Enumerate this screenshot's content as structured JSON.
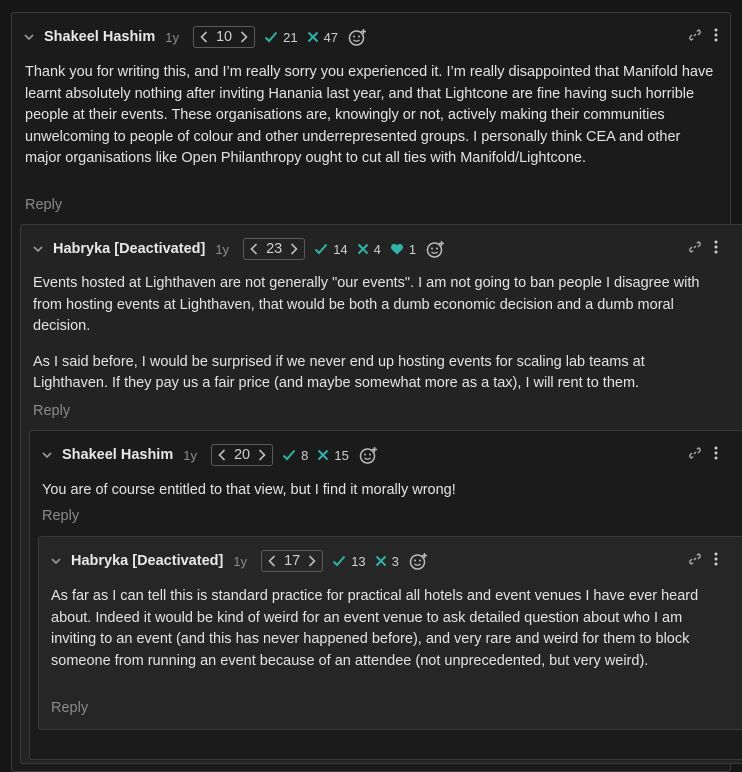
{
  "colors": {
    "accent": "#2fb3a8",
    "text": "#e3e3e3",
    "muted": "#8a8a8a",
    "border": "#3a3a3a"
  },
  "reply_label": "Reply",
  "comments": [
    {
      "author": "Shakeel Hashim",
      "age": "1y",
      "karma": "10",
      "agree": "21",
      "disagree": "47",
      "paragraphs": [
        "Thank you for writing this, and I’m really sorry you experienced it. I’m really disappointed that Manifold have learnt absolutely nothing after inviting Hanania last year, and that Lightcone are fine having such horrible people at their events. These organisations are, knowingly or not, actively making their communities unwelcoming to people of colour and other underrepresented groups. I personally think CEA and other major organisations like Open Philanthropy ought to cut all ties with Manifold/Lightcone."
      ]
    },
    {
      "author": "Habryka [Deactivated]",
      "age": "1y",
      "karma": "23",
      "agree": "14",
      "disagree": "4",
      "hearts": "1",
      "paragraphs": [
        "Events hosted at Lighthaven are not generally \"our events\". I am not going to ban people I disagree with from hosting events at Lighthaven, that would be both a dumb economic decision and a dumb moral decision.",
        "As I said before, I would be surprised if we never end up hosting events for scaling lab teams at Lighthaven. If they pay us a fair price (and maybe somewhat more as a tax), I will rent to them."
      ]
    },
    {
      "author": "Shakeel Hashim",
      "age": "1y",
      "karma": "20",
      "agree": "8",
      "disagree": "15",
      "paragraphs": [
        "You are of course entitled to that view, but I find it morally wrong!"
      ]
    },
    {
      "author": "Habryka [Deactivated]",
      "age": "1y",
      "karma": "17",
      "agree": "13",
      "disagree": "3",
      "paragraphs": [
        "As far as I can tell this is standard practice for practical all hotels and event venues I have ever heard about. Indeed it would be kind of weird for an event venue to ask detailed question about who I am inviting to an event (and this has never happened before), and very rare and weird for them to block someone from running an event because of an attendee (not unprecedented, but very weird)."
      ]
    }
  ]
}
